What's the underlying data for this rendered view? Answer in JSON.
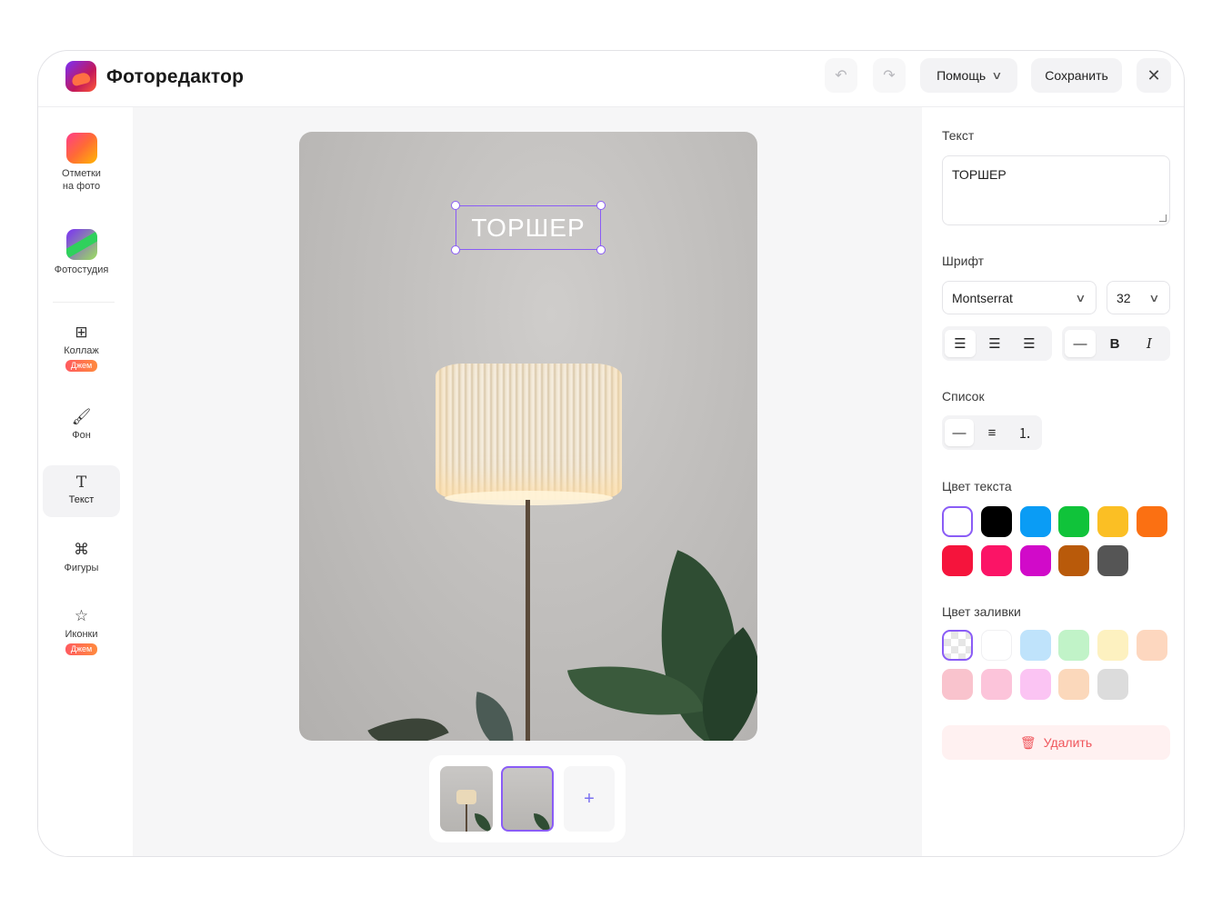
{
  "header": {
    "app_title": "Фоторедактор",
    "undo_icon": "undo-icon",
    "redo_icon": "redo-icon",
    "help_label": "Помощь",
    "save_label": "Сохранить",
    "close_icon": "close-icon"
  },
  "sidebar": {
    "items": [
      {
        "label": "Отметки\nна фото",
        "icon": "marks-icon"
      },
      {
        "label": "Фотостудия",
        "icon": "photostudio-icon"
      },
      {
        "label": "Коллаж",
        "icon": "collage-icon",
        "badge": "Джем"
      },
      {
        "label": "Фон",
        "icon": "background-icon"
      },
      {
        "label": "Текст",
        "icon": "text-icon",
        "active": true
      },
      {
        "label": "Фигуры",
        "icon": "shapes-icon"
      },
      {
        "label": "Иконки",
        "icon": "icons-icon",
        "badge": "Джем"
      }
    ]
  },
  "canvas": {
    "overlay_text": "ТОРШЕР",
    "add_page_icon": "plus-icon",
    "thumbnails": [
      {
        "selected": false
      },
      {
        "selected": true
      }
    ]
  },
  "panel": {
    "text_label": "Текст",
    "text_value": "ТОРШЕР",
    "font_label": "Шрифт",
    "font_value": "Montserrat",
    "size_value": "32",
    "bold_label": "B",
    "italic_label": "I",
    "list_label": "Список",
    "text_color_label": "Цвет текста",
    "text_colors": [
      "#ffffff",
      "#000000",
      "#0a9cf5",
      "#10c33a",
      "#fbbf24",
      "#fb7012",
      "#f5143c",
      "#fb1466",
      "#d10ac9",
      "#b95a0a",
      "#555555"
    ],
    "fill_color_label": "Цвет заливки",
    "fill_colors": [
      "transparent",
      "#ffffff",
      "#bfe3fb",
      "#c1f3c8",
      "#fdf1c0",
      "#fdd7bf",
      "#f9c3cd",
      "#fcc4da",
      "#fbc4f3",
      "#fbd8bb",
      "#dcdcdc"
    ],
    "delete_label": "Удалить",
    "accent_color": "#8a5cf6"
  }
}
